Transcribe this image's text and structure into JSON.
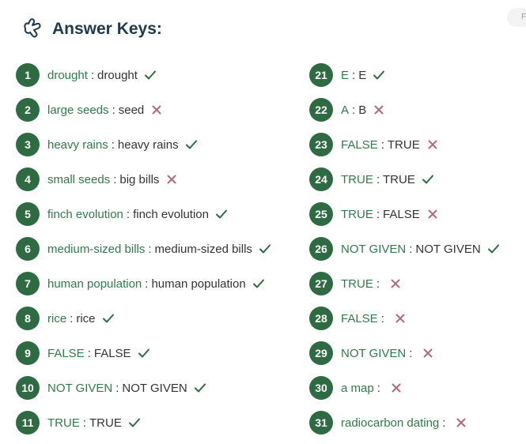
{
  "header": {
    "title": "Answer Keys:",
    "icon": "answer-key-icon"
  },
  "colors": {
    "accent": "#2e6b43",
    "correct": "#2e6b43",
    "wrong": "#b0697a",
    "title": "#1f3a4d"
  },
  "corner_label": "F",
  "answers_left": [
    {
      "number": "1",
      "your_answer": "drought",
      "correct_answer": "drought",
      "result": "correct"
    },
    {
      "number": "2",
      "your_answer": "large seeds",
      "correct_answer": "seed",
      "result": "wrong"
    },
    {
      "number": "3",
      "your_answer": "heavy rains",
      "correct_answer": "heavy rains",
      "result": "correct"
    },
    {
      "number": "4",
      "your_answer": "small seeds",
      "correct_answer": "big bills",
      "result": "wrong"
    },
    {
      "number": "5",
      "your_answer": "finch evolution",
      "correct_answer": "finch evolution",
      "result": "correct"
    },
    {
      "number": "6",
      "your_answer": "medium-sized bills",
      "correct_answer": "medium-sized bills",
      "result": "correct"
    },
    {
      "number": "7",
      "your_answer": "human population",
      "correct_answer": "human population",
      "result": "correct"
    },
    {
      "number": "8",
      "your_answer": "rice",
      "correct_answer": "rice",
      "result": "correct"
    },
    {
      "number": "9",
      "your_answer": "FALSE",
      "correct_answer": "FALSE",
      "result": "correct"
    },
    {
      "number": "10",
      "your_answer": "NOT GIVEN",
      "correct_answer": "NOT GIVEN",
      "result": "correct"
    },
    {
      "number": "11",
      "your_answer": "TRUE",
      "correct_answer": "TRUE",
      "result": "correct"
    }
  ],
  "answers_right": [
    {
      "number": "21",
      "your_answer": "E",
      "correct_answer": "E",
      "result": "correct"
    },
    {
      "number": "22",
      "your_answer": "A",
      "correct_answer": "B",
      "result": "wrong"
    },
    {
      "number": "23",
      "your_answer": "FALSE",
      "correct_answer": "TRUE",
      "result": "wrong"
    },
    {
      "number": "24",
      "your_answer": "TRUE",
      "correct_answer": "TRUE",
      "result": "correct"
    },
    {
      "number": "25",
      "your_answer": "TRUE",
      "correct_answer": "FALSE",
      "result": "wrong"
    },
    {
      "number": "26",
      "your_answer": "NOT GIVEN",
      "correct_answer": "NOT GIVEN",
      "result": "correct"
    },
    {
      "number": "27",
      "your_answer": "TRUE",
      "correct_answer": "",
      "result": "wrong"
    },
    {
      "number": "28",
      "your_answer": "FALSE",
      "correct_answer": "",
      "result": "wrong"
    },
    {
      "number": "29",
      "your_answer": "NOT GIVEN",
      "correct_answer": "",
      "result": "wrong"
    },
    {
      "number": "30",
      "your_answer": "a map",
      "correct_answer": "",
      "result": "wrong"
    },
    {
      "number": "31",
      "your_answer": "radiocarbon dating",
      "correct_answer": "",
      "result": "wrong"
    }
  ]
}
